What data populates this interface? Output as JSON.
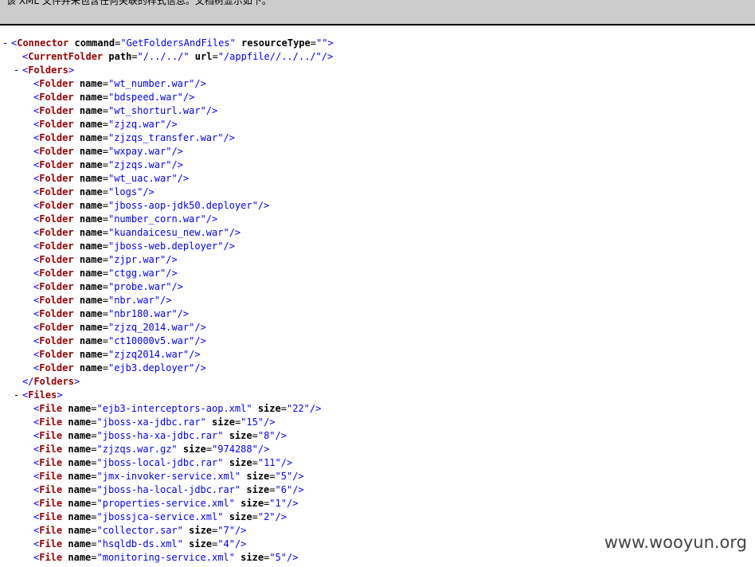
{
  "info_banner": {
    "text": "该 XML 文件并未包含任何关联的样式信息。文档树显示如下。"
  },
  "xml": {
    "connector": {
      "tag": "Connector",
      "command": "GetFoldersAndFiles",
      "resourceType": ""
    },
    "current_folder": {
      "tag": "CurrentFolder",
      "path": "/../../",
      "url": "/appfile//../../"
    },
    "folders_tag": "Folders",
    "folders": [
      "wt_number.war",
      "bdspeed.war",
      "wt_shorturl.war",
      "zjzq.war",
      "zjzqs_transfer.war",
      "wxpay.war",
      "zjzqs.war",
      "wt_uac.war",
      "logs",
      "jboss-aop-jdk50.deployer",
      "number_corn.war",
      "kuandaicesu_new.war",
      "jboss-web.deployer",
      "zjpr.war",
      "ctgg.war",
      "probe.war",
      "nbr.war",
      "nbr180.war",
      "zjzq_2014.war",
      "ct10000v5.war",
      "zjzq2014.war",
      "ejb3.deployer"
    ],
    "files_tag": "Files",
    "files": [
      {
        "name": "ejb3-interceptors-aop.xml",
        "size": "22"
      },
      {
        "name": "jboss-xa-jdbc.rar",
        "size": "15"
      },
      {
        "name": "jboss-ha-xa-jdbc.rar",
        "size": "8"
      },
      {
        "name": "zjzqs.war.gz",
        "size": "974288"
      },
      {
        "name": "jboss-local-jdbc.rar",
        "size": "11"
      },
      {
        "name": "jmx-invoker-service.xml",
        "size": "5"
      },
      {
        "name": "jboss-ha-local-jdbc.rar",
        "size": "6"
      },
      {
        "name": "properties-service.xml",
        "size": "1"
      },
      {
        "name": "jbossjca-service.xml",
        "size": "2"
      },
      {
        "name": "collector.sar",
        "size": "7"
      },
      {
        "name": "hsqldb-ds.xml",
        "size": "4"
      },
      {
        "name": "monitoring-service.xml",
        "size": "5"
      }
    ]
  },
  "watermark": "www.wooyun.org"
}
